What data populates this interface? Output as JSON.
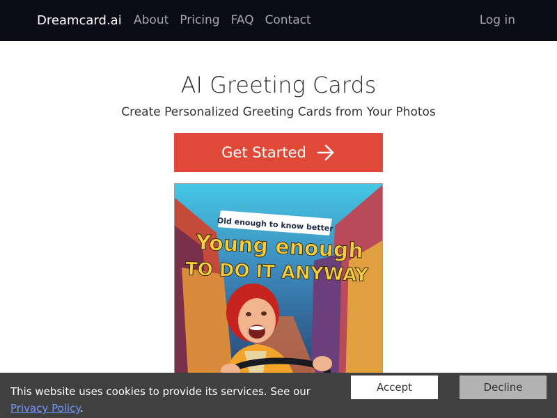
{
  "nav": {
    "brand": "Dreamcard.ai",
    "links": [
      "About",
      "Pricing",
      "FAQ",
      "Contact"
    ],
    "login": "Log in"
  },
  "hero": {
    "title": "AI Greeting Cards",
    "subtitle": "Create Personalized Greeting Cards from Your Photos",
    "cta_label": "Get Started",
    "cta_icon": "arrow-right-icon"
  },
  "card": {
    "tag_text": "Old enough to know better",
    "line1": "Young enough",
    "line2": "TO DO IT ANYWAY"
  },
  "cookie": {
    "text": "This website uses cookies to provide its services. See our",
    "link": "Privacy Policy",
    "suffix": ".",
    "accept": "Accept",
    "decline": "Decline"
  },
  "colors": {
    "nav_bg": "#0b0b17",
    "cta_bg": "#e04838",
    "cookie_bg": "#404040",
    "link": "#6e95ff",
    "card_headline": "#f6cf3c"
  }
}
